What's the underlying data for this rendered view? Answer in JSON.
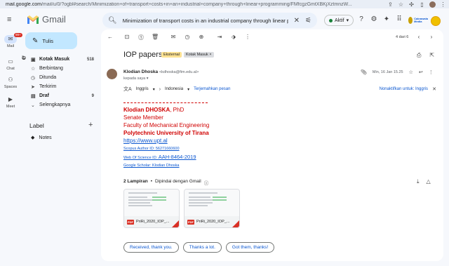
{
  "browser": {
    "url_host": "mail.google.com",
    "url_path": "/mail/u/0/?ogbl#search/Minimization+of+transport+costs+in+an+industrial+company+through+linear+programming/FMfcgzGmtXBKjXztmnzW..."
  },
  "app": {
    "name": "Gmail",
    "search_query": "Minimization of transport costs in an industrial company through linear pr",
    "status_label": "Aktif",
    "org_logo_text": "Cakrawala Media",
    "colors": {
      "accent": "#0b57d0",
      "compose": "#c2e7ff",
      "badge": "#d93025",
      "signature": "#d00000"
    }
  },
  "rail": {
    "mail_label": "Mail",
    "mail_badge": "99+",
    "chat_label": "Chat",
    "spaces_label": "Spaces",
    "meet_label": "Meet"
  },
  "nav": {
    "compose_label": "Tulis",
    "items": [
      {
        "label": "Kotak Masuk",
        "count": "518",
        "icon": "inbox-icon"
      },
      {
        "label": "Berbintang",
        "count": "",
        "icon": "star-icon"
      },
      {
        "label": "Ditunda",
        "count": "",
        "icon": "clock-icon"
      },
      {
        "label": "Terkirim",
        "count": "",
        "icon": "send-icon"
      },
      {
        "label": "Draf",
        "count": "9",
        "icon": "draft-icon"
      },
      {
        "label": "Selengkapnya",
        "count": "",
        "icon": "chevron-down-icon"
      }
    ],
    "label_heading": "Label",
    "labels": [
      {
        "label": "Notes"
      }
    ]
  },
  "toolbar": {
    "page_info": "4 dari 6"
  },
  "message": {
    "subject": "IOP papers",
    "tag_external": "Eksternal",
    "tag_inbox": "Kotak Masuk",
    "sender_name": "Klodian Dhoska",
    "sender_email": "<kdhoska@fim.edu.al>",
    "to": "kepada saya",
    "date": "Min, 16 Jan 15.25",
    "translate_from": "Inggris",
    "translate_to": "Indonesia",
    "translate_action": "Terjemahkan pesan",
    "translate_off": "Nonaktifkan untuk: Inggris",
    "signature": {
      "name": "Klodian DHOSKA",
      "degree": ", PhD",
      "role": "Senate Member",
      "faculty": "Faculty of Mechanical Engineering",
      "university": "Polytechnic University of Tirana",
      "website": "https://www.upt.al",
      "scopus": "Scopus Author ID: 56271660600",
      "wos_label": "Web Of Science ID: ",
      "wos_id": "AAH-8464-2019",
      "scholar": "Google Scholar: Klodian Dhoska"
    },
    "attachments_label": "2 Lampiran",
    "attachments_scan": "Dipindai dengan Gmail",
    "attachments": [
      {
        "name": "PriRi_2020_IOP_..."
      },
      {
        "name": "PriRi_2020_IOP_..."
      }
    ],
    "smart_replies": [
      "Received, thank you.",
      "Thanks a lot.",
      "Got them, thanks!"
    ]
  }
}
